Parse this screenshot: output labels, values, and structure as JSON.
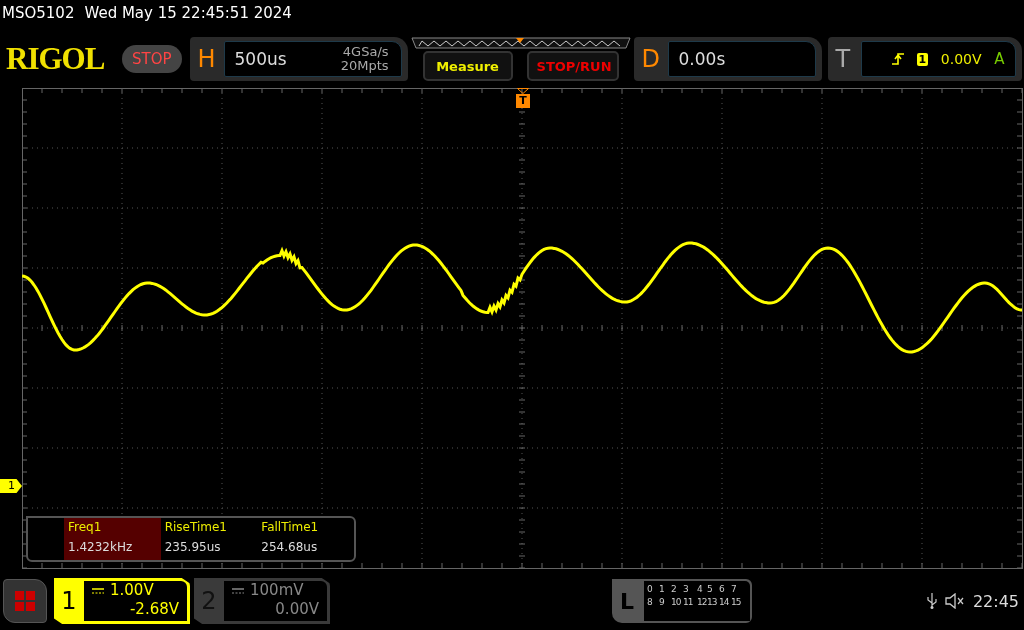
{
  "status_line": {
    "model": "MSO5102",
    "datetime": "Wed May 15 22:45:51 2024"
  },
  "header": {
    "logo": "RIGOL",
    "run_state": "STOP",
    "horizontal": {
      "letter": "H",
      "timebase": "500us",
      "sample_rate": "4GSa/s",
      "memory_depth": "20Mpts"
    },
    "buttons": [
      {
        "label": "Measure",
        "kind": "menu"
      },
      {
        "label": "STOP/RUN",
        "kind": "action"
      }
    ],
    "delay": {
      "letter": "D",
      "value": "0.00s"
    },
    "trigger": {
      "letter": "T",
      "source": "1",
      "level": "0.00V",
      "mode": "A"
    }
  },
  "markers": {
    "trigger": "T",
    "channel": "1"
  },
  "measurements": [
    {
      "name": "Freq1",
      "value": "1.4232kHz",
      "selected": true
    },
    {
      "name": "RiseTime1",
      "value": "235.95us",
      "selected": false
    },
    {
      "name": "FallTime1",
      "value": "254.68us",
      "selected": false
    }
  ],
  "channels": [
    {
      "number": "1",
      "scale": "1.00V",
      "offset": "-2.68V",
      "on": true
    },
    {
      "number": "2",
      "scale": "100mV",
      "offset": "0.00V",
      "on": false
    }
  ],
  "logic": {
    "letter": "L",
    "rows": [
      [
        "0",
        "1",
        "2",
        "3",
        "4",
        "5",
        "6",
        "7"
      ],
      [
        "8",
        "9",
        "10",
        "11",
        "12",
        "13",
        "14",
        "15"
      ]
    ]
  },
  "status_bar": {
    "time": "22:45"
  }
}
